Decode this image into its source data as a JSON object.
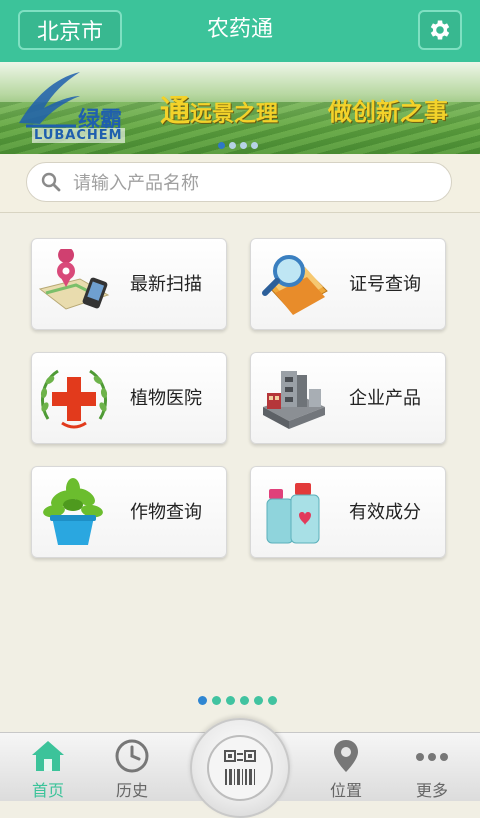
{
  "header": {
    "city_label": "北京市",
    "title": "农药通",
    "settings_icon": "gear-icon",
    "color": "#3cc39a"
  },
  "banner": {
    "logo_cn": "绿霸",
    "logo_en": "LUBACHEM",
    "slogan_big": "通",
    "slogan_rest": "远景之理",
    "slogan2": "做创新之事",
    "page_count": 4,
    "active_page": 1
  },
  "search": {
    "placeholder": "请输入产品名称",
    "icon": "search-icon"
  },
  "features": [
    {
      "label": "最新扫描",
      "icon": "map-phone-icon"
    },
    {
      "label": "证号查询",
      "icon": "folder-magnifier-icon"
    },
    {
      "label": "植物医院",
      "icon": "red-cross-icon"
    },
    {
      "label": "企业产品",
      "icon": "factory-icon"
    },
    {
      "label": "作物查询",
      "icon": "potted-plant-icon"
    },
    {
      "label": "有效成分",
      "icon": "bottles-icon"
    }
  ],
  "pager": {
    "count": 6,
    "active": 1
  },
  "tabbar": {
    "items": [
      {
        "label": "首页",
        "icon": "home-icon",
        "active": true
      },
      {
        "label": "历史",
        "icon": "clock-icon",
        "active": false
      },
      {
        "label": "位置",
        "icon": "location-pin-icon",
        "active": false
      },
      {
        "label": "更多",
        "icon": "more-dots-icon",
        "active": false
      }
    ],
    "scan_icon": "qr-barcode-icon"
  }
}
